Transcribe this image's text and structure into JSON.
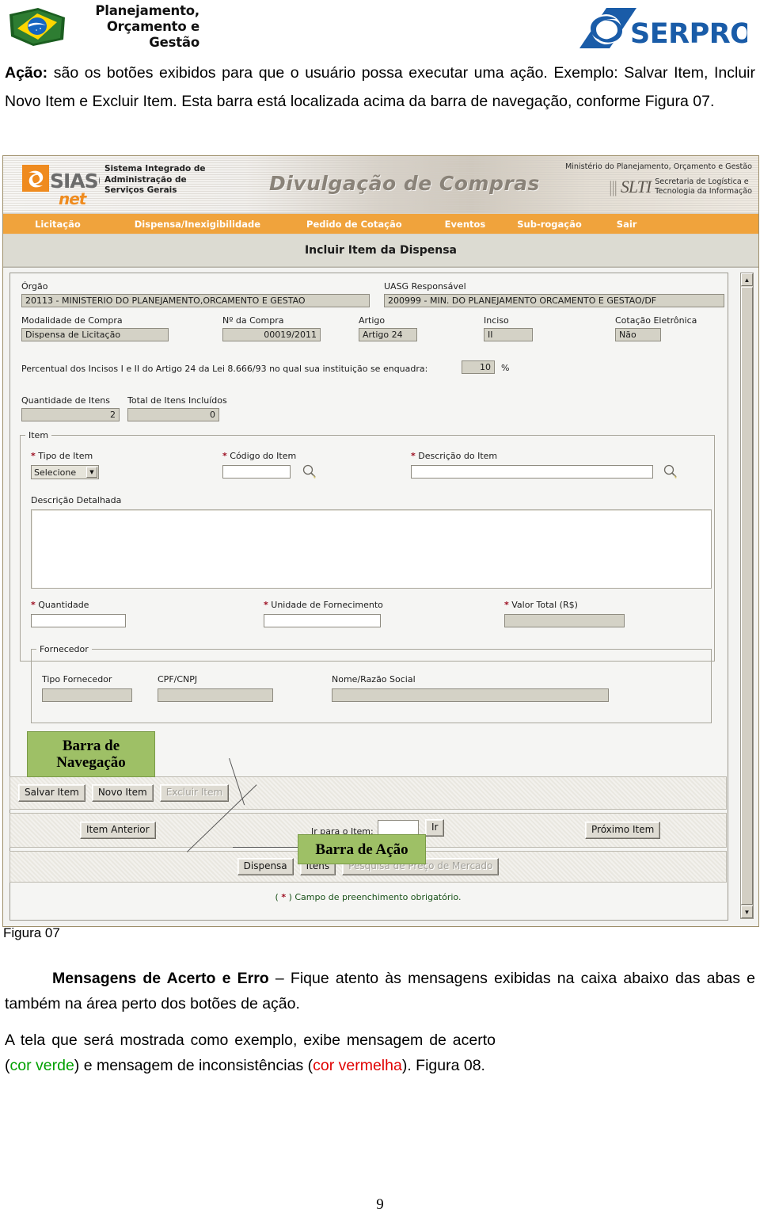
{
  "doc_header": {
    "ministry_lines": "Planejamento,\nOrçamento e\nGestão",
    "serpro_label": "SERPRO",
    "flag_icon": "brazil-flag-icon"
  },
  "intro": {
    "bold_lead": "Ação:",
    "text": " são os botões exibidos para que o usuário possa executar uma ação. Exemplo: Salvar Item, Incluir Novo Item e Excluir Item. Esta barra está localizada acima da barra de navegação, conforme Figura 07."
  },
  "figure": {
    "caption": "Figura 07",
    "banner": {
      "siasg_logo_text": "SIASG",
      "siasg_net": "net",
      "siasg_subtitle": "Sistema Integrado de\nAdministração de\nServiços Gerais",
      "center_title": "Divulgação de Compras",
      "ministry_right": "Ministério do Planejamento, Orçamento e Gestão",
      "slti_mark": "SLTI",
      "slti_text": "Secretaria de Logística e\nTecnologia da Informação"
    },
    "nav": {
      "items": [
        {
          "label": "Licitação"
        },
        {
          "label": "Dispensa/Inexigibilidade"
        },
        {
          "label": "Pedido de Cotação"
        },
        {
          "label": "Eventos"
        },
        {
          "label": "Sub-rogação"
        },
        {
          "label": "Sair"
        }
      ]
    },
    "page_title": "Incluir Item da Dispensa",
    "header_fields": {
      "orgao_label": "Órgão",
      "orgao_value": "20113 - MINISTERIO DO PLANEJAMENTO,ORCAMENTO E GESTAO",
      "uasg_label": "UASG Responsável",
      "uasg_value": "200999 - MIN. DO PLANEJAMENTO ORCAMENTO E GESTAO/DF",
      "modalidade_label": "Modalidade de Compra",
      "modalidade_value": "Dispensa de Licitação",
      "numero_label": "Nº da Compra",
      "numero_value": "00019/2011",
      "artigo_label": "Artigo",
      "artigo_value": "Artigo 24",
      "inciso_label": "Inciso",
      "inciso_value": "II",
      "cotacao_label": "Cotação Eletrônica",
      "cotacao_value": "Não",
      "percentual_label": "Percentual dos Incisos I e II do Artigo 24 da Lei 8.666/93 no qual sua instituição se enquadra:",
      "percentual_value": "10",
      "percentual_suffix": "%"
    },
    "counters": {
      "qtd_itens_label": "Quantidade de Itens",
      "qtd_itens_value": "2",
      "total_incluidos_label": "Total de Itens Incluídos",
      "total_incluidos_value": "0"
    },
    "item_group": {
      "legend": "Item",
      "tipo_item_label": "Tipo de Item",
      "tipo_item_value": "Selecione",
      "codigo_item_label": "Código do Item",
      "codigo_item_value": "",
      "descricao_item_label": "Descrição do Item",
      "descricao_item_value": "",
      "descricao_detalhada_label": "Descrição Detalhada",
      "descricao_detalhada_value": "",
      "quantidade_label": "Quantidade",
      "quantidade_value": "",
      "unidade_label": "Unidade de Fornecimento",
      "unidade_value": "",
      "valor_total_label": "Valor Total (R$)",
      "valor_total_value": "",
      "search_icon": "magnifier-icon"
    },
    "fornecedor_group": {
      "legend": "Fornecedor",
      "tipo_label": "Tipo Fornecedor",
      "tipo_value": "",
      "cpf_cnpj_label": "CPF/CNPJ",
      "cpf_cnpj_value": "",
      "nome_label": "Nome/Razão Social",
      "nome_value": ""
    },
    "action_bar": {
      "salvar": "Salvar Item",
      "novo": "Novo Item",
      "excluir": "Excluir Item"
    },
    "nav_bar": {
      "item_anterior": "Item Anterior",
      "ir_para_item_label": "Ir para o Item:",
      "ir_para_item_value": "",
      "ir": "Ir",
      "proximo_item": "Próximo Item"
    },
    "tabs_bar": {
      "dispensa": "Dispensa",
      "itens": "Itens",
      "pesquisa": "Pesquisa de Preço de Mercado"
    },
    "obligatory_note": {
      "prefix": "( ",
      "star": "*",
      "suffix": " ) Campo de preenchimento obrigatório."
    },
    "annotations": {
      "nav_callout": "Barra de\nNavegação",
      "action_callout": "Barra de Ação",
      "callout_color": "#9ec066"
    },
    "scrollbar": {
      "up_arrow": "▲",
      "down_arrow": "▼"
    }
  },
  "body": {
    "p1_bold": "Mensagens de Acerto e Erro",
    "p1_rest": " – Fique atento às mensagens exibidas na caixa abaixo das abas e também na área perto dos botões de ação.",
    "p2_a": "A tela que será mostrada como exemplo, exibe mensagem de acerto (",
    "p2_green": "cor verde",
    "p2_b": ") e mensagem de inconsistências (",
    "p2_red": "cor vermelha",
    "p2_c": "). Figura 08."
  },
  "page_number": "9"
}
